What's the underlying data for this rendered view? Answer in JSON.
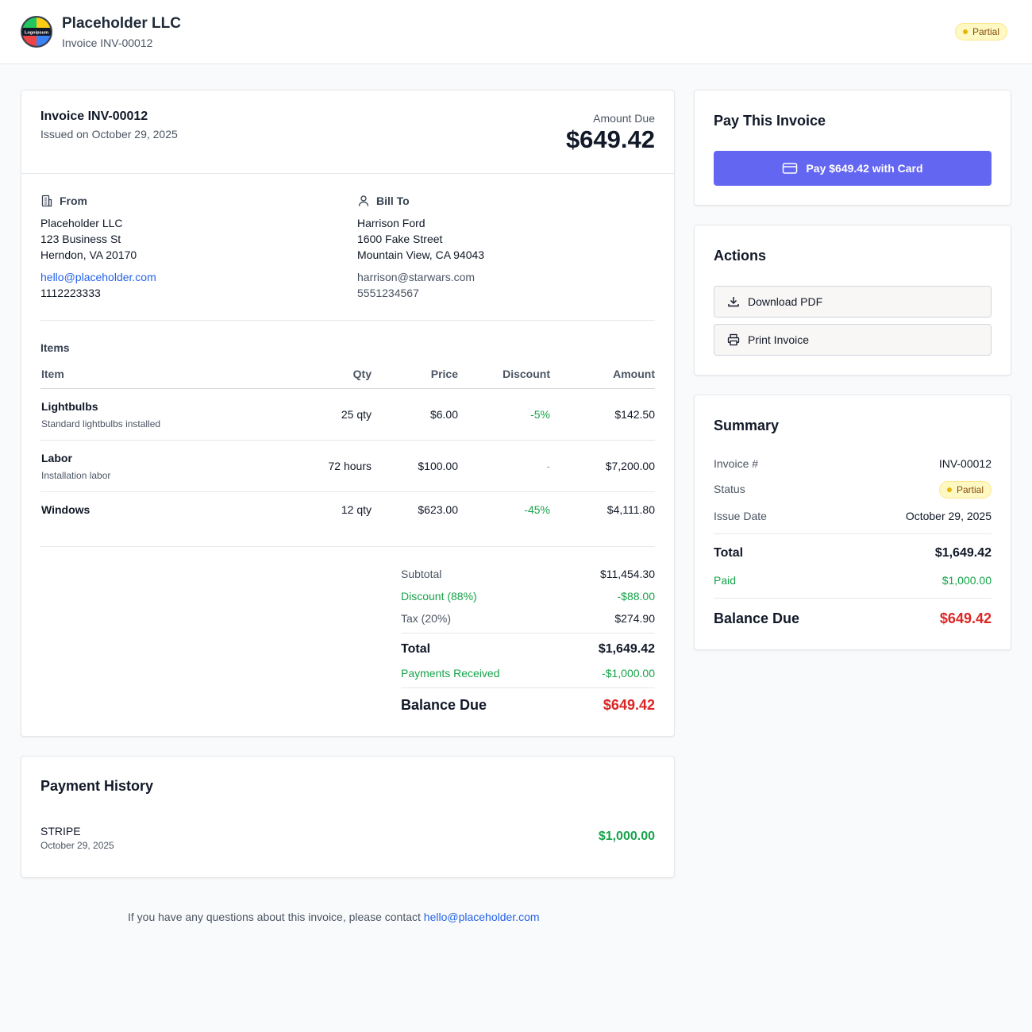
{
  "header": {
    "logo_text": "Logoipsum",
    "company": "Placeholder LLC",
    "invoice_label": "Invoice INV-00012",
    "status": "Partial"
  },
  "invoice": {
    "title": "Invoice INV-00012",
    "issued": "Issued on October 29, 2025",
    "amount_due_label": "Amount Due",
    "amount_due": "$649.42",
    "from": {
      "label": "From",
      "name": "Placeholder LLC",
      "street": "123 Business St",
      "city": "Herndon, VA 20170",
      "email": "hello@placeholder.com",
      "phone": "1112223333"
    },
    "bill_to": {
      "label": "Bill To",
      "name": "Harrison Ford",
      "street": "1600 Fake Street",
      "city": "Mountain View, CA 94043",
      "email": "harrison@starwars.com",
      "phone": "5551234567"
    },
    "items_label": "Items",
    "columns": {
      "item": "Item",
      "qty": "Qty",
      "price": "Price",
      "discount": "Discount",
      "amount": "Amount"
    },
    "items": [
      {
        "name": "Lightbulbs",
        "desc": "Standard lightbulbs installed",
        "qty": "25 qty",
        "price": "$6.00",
        "discount": "-5%",
        "amount": "$142.50"
      },
      {
        "name": "Labor",
        "desc": "Installation labor",
        "qty": "72 hours",
        "price": "$100.00",
        "discount": "-",
        "amount": "$7,200.00"
      },
      {
        "name": "Windows",
        "desc": "",
        "qty": "12 qty",
        "price": "$623.00",
        "discount": "-45%",
        "amount": "$4,111.80"
      }
    ],
    "totals": {
      "subtotal_label": "Subtotal",
      "subtotal": "$11,454.30",
      "discount_label": "Discount (88%)",
      "discount": "-$88.00",
      "tax_label": "Tax (20%)",
      "tax": "$274.90",
      "total_label": "Total",
      "total": "$1,649.42",
      "payments_label": "Payments Received",
      "payments": "-$1,000.00",
      "balance_label": "Balance Due",
      "balance": "$649.42"
    }
  },
  "payment_history": {
    "title": "Payment History",
    "entries": [
      {
        "method": "STRIPE",
        "date": "October 29, 2025",
        "amount": "$1,000.00"
      }
    ]
  },
  "footer": {
    "text": "If you have any questions about this invoice, please contact ",
    "email": "hello@placeholder.com"
  },
  "pay_card": {
    "title": "Pay This Invoice",
    "button": "Pay $649.42 with Card"
  },
  "actions": {
    "title": "Actions",
    "download": "Download PDF",
    "print": "Print Invoice"
  },
  "summary": {
    "title": "Summary",
    "invoice_no_label": "Invoice #",
    "invoice_no": "INV-00012",
    "status_label": "Status",
    "status": "Partial",
    "issue_date_label": "Issue Date",
    "issue_date": "October 29, 2025",
    "total_label": "Total",
    "total": "$1,649.42",
    "paid_label": "Paid",
    "paid": "$1,000.00",
    "balance_label": "Balance Due",
    "balance": "$649.42"
  },
  "colors": {
    "accent": "#6366f1",
    "success": "#16a34a",
    "danger": "#dc2626",
    "link": "#2563eb",
    "badge_bg": "#fef9c3"
  }
}
